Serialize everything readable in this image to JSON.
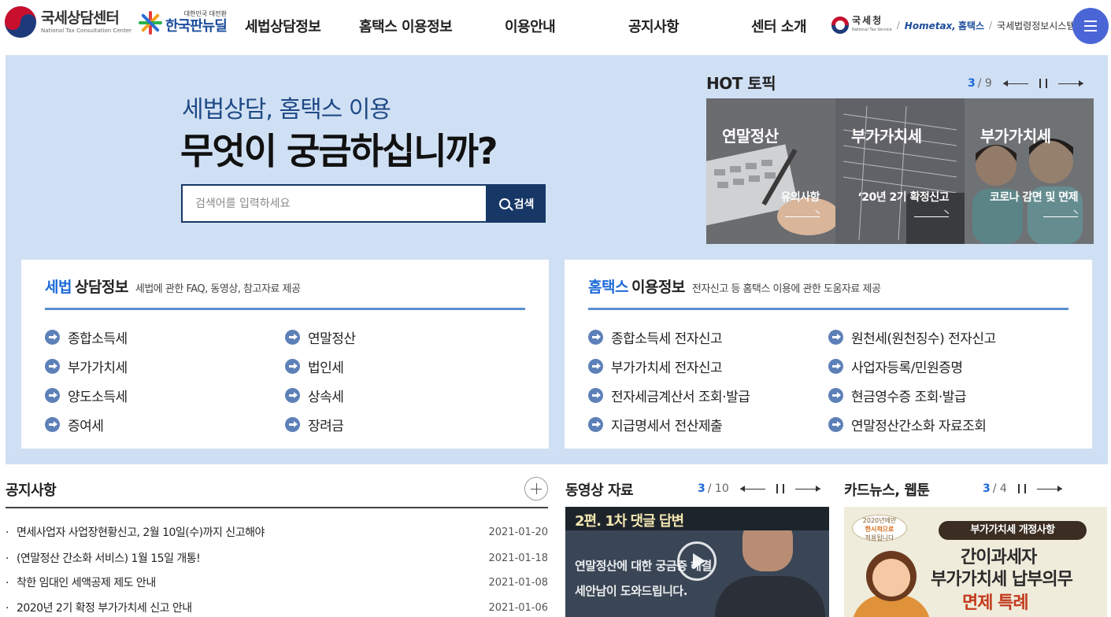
{
  "header": {
    "logo_title": "국세상담센터",
    "logo_sub": "National Tax Consultation Center",
    "partner_logo_small": "대한민국 대전환",
    "partner_logo_title": "한국판뉴딜",
    "nav": [
      "세법상담정보",
      "홈택스 이용정보",
      "이용안내",
      "공지사항",
      "센터 소개"
    ],
    "nts_name": "국세청",
    "nts_sub": "National Tax Service",
    "hometax_en": "Hometax,",
    "hometax_ko": "홈택스",
    "law_system": "국세법령정보시스템",
    "separator": "/"
  },
  "hero": {
    "subtitle": "세법상담, 홈택스 이용",
    "title": "무엇이 궁금하십니까?",
    "search_placeholder": "검색어를 입력하세요",
    "search_button": "검색"
  },
  "hot": {
    "title": "HOT 토픽",
    "current": "3",
    "total": "/ 9",
    "cards": [
      {
        "title": "연말정산",
        "desc": "유의사항"
      },
      {
        "title": "부가가치세",
        "desc": "‘20년 2기 확정신고"
      },
      {
        "title": "부가가치세",
        "desc": "코로나 감면 및 면제"
      }
    ]
  },
  "tax_panel": {
    "highlight": "세법",
    "title": "상담정보",
    "desc": "세법에 관한 FAQ, 동영상, 참고자료 제공",
    "items": [
      "종합소득세",
      "연말정산",
      "부가가치세",
      "법인세",
      "양도소득세",
      "상속세",
      "증여세",
      "장려금"
    ]
  },
  "hometax_panel": {
    "highlight": "홈택스",
    "title": "이용정보",
    "desc": "전자신고 등 홈택스 이용에 관한 도움자료 제공",
    "items": [
      "종합소득세 전자신고",
      "원천세(원천징수) 전자신고",
      "부가가치세 전자신고",
      "사업자등록/민원증명",
      "전자세금계산서 조회·발급",
      "현금영수증 조회·발급",
      "지급명세서 전산제출",
      "연말정산간소화 자료조회"
    ]
  },
  "notice": {
    "title": "공지사항",
    "rows": [
      {
        "text": "면세사업자 사업장현황신고, 2월 10일(수)까지 신고해야",
        "date": "2021-01-20"
      },
      {
        "text": "(연말정산 간소화 서비스) 1월 15일 개통!",
        "date": "2021-01-18"
      },
      {
        "text": "착한 임대인 세액공제 제도 안내",
        "date": "2021-01-08"
      },
      {
        "text": "2020년 2기 확정 부가가치세 신고 안내",
        "date": "2021-01-06"
      }
    ]
  },
  "video": {
    "title": "동영상 자료",
    "current": "3",
    "total": "/ 10",
    "band_text": "2편. 1차 댓글 답변",
    "caption1": "연말정산에 대한 궁금증 해결",
    "caption2": "세안남이 도와드립니다."
  },
  "cardnews": {
    "title": "카드뉴스, 웹툰",
    "current": "3",
    "total": "/ 4",
    "stamp_line1": "2020년에만",
    "stamp_line2": "한시적으로",
    "stamp_line3": "적용됩니다",
    "badge": "부가가치세 개정사항",
    "line1": "간이과세자",
    "line2": "부가가치세 납부의무",
    "line3": "면제 특례"
  }
}
